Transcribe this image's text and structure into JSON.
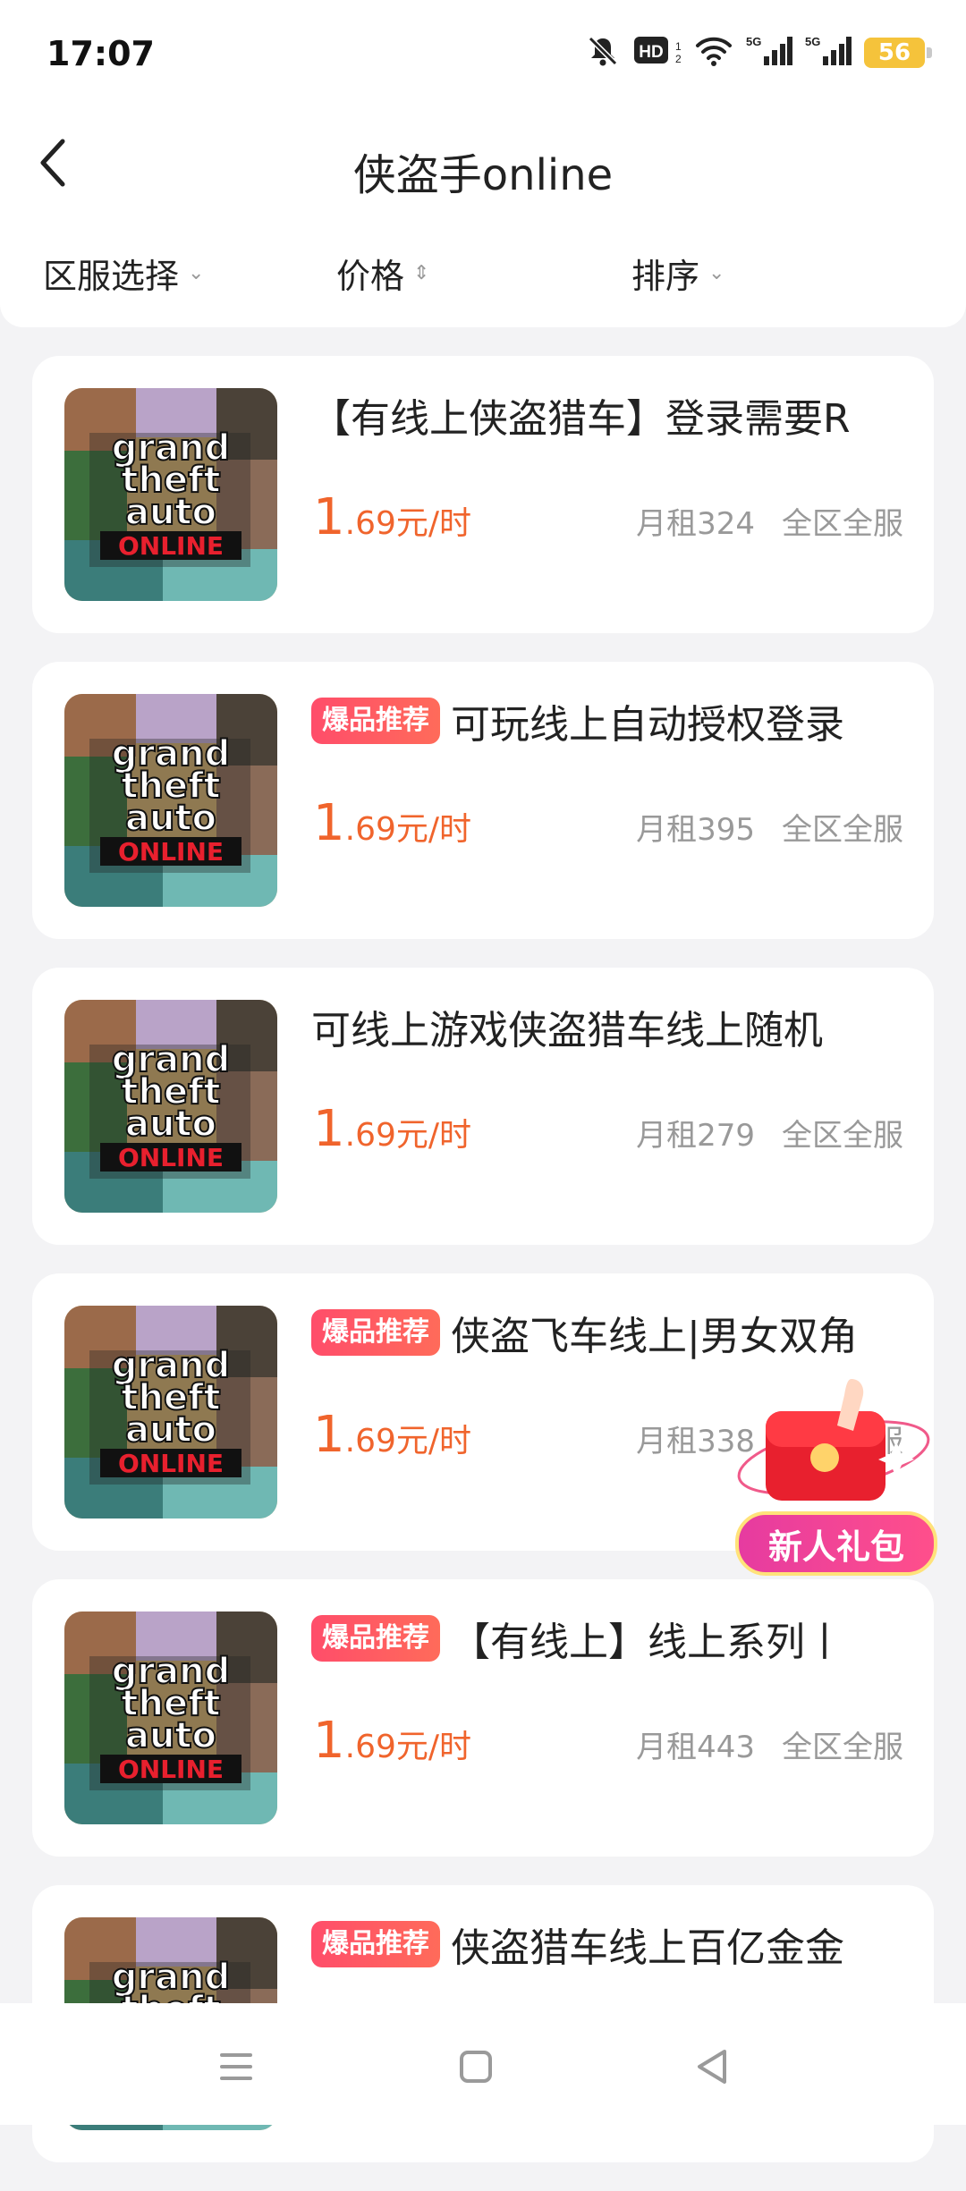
{
  "status": {
    "time": "17:07",
    "hd_label": "HD",
    "signal_label_1": "5G",
    "signal_label_2": "5G",
    "battery": "56",
    "icons": [
      "mute-bell-icon",
      "hd-icon",
      "wifi-icon",
      "signal-5g-icon",
      "signal-5g-icon",
      "battery-icon"
    ]
  },
  "header": {
    "title": "侠盗手online"
  },
  "filters": {
    "region": "区服选择",
    "price": "价格",
    "sort": "排序"
  },
  "cover_art": {
    "line1": "grand",
    "line2": "theft",
    "line3": "auto",
    "line4": "ONLINE"
  },
  "listings": [
    {
      "badge": "",
      "title": "【有线上侠盗猎车】登录需要R",
      "price_int": "1",
      "price_rest": ".69元/时",
      "monthly": "月租324",
      "scope": "全区全服"
    },
    {
      "badge": "爆品推荐",
      "title": "可玩线上自动授权登录",
      "price_int": "1",
      "price_rest": ".69元/时",
      "monthly": "月租395",
      "scope": "全区全服"
    },
    {
      "badge": "",
      "title": "可线上游戏侠盗猎车线上随机",
      "price_int": "1",
      "price_rest": ".69元/时",
      "monthly": "月租279",
      "scope": "全区全服"
    },
    {
      "badge": "爆品推荐",
      "title": "侠盗飞车线上|男女双角",
      "price_int": "1",
      "price_rest": ".69元/时",
      "monthly": "月租338",
      "scope": "全区全服"
    },
    {
      "badge": "爆品推荐",
      "title": "【有线上】线上系列丨",
      "price_int": "1",
      "price_rest": ".69元/时",
      "monthly": "月租443",
      "scope": "全区全服"
    },
    {
      "badge": "爆品推荐",
      "title": "侠盗猎车线上百亿金金",
      "price_int": "",
      "price_rest": "",
      "monthly": "",
      "scope": ""
    }
  ],
  "gift": {
    "label": "新人礼包"
  },
  "colors": {
    "price": "#f0642c",
    "badge": "#ff4d6a",
    "background": "#f3f3f5"
  }
}
